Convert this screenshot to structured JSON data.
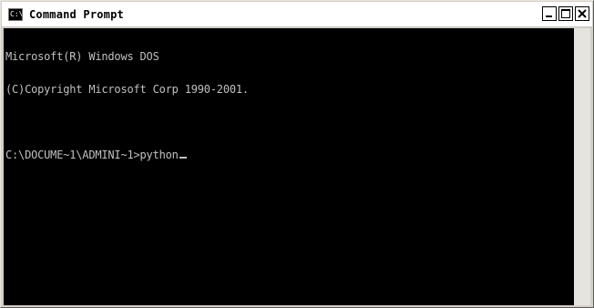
{
  "window": {
    "title": "Command Prompt",
    "icon": "cmd-icon",
    "icon_text": "C:\\",
    "controls": {
      "minimize_icon": "minimize-icon",
      "maximize_icon": "maximize-icon",
      "close_icon": "close-icon"
    }
  },
  "console": {
    "lines": [
      "Microsoft(R) Windows DOS",
      "(C)Copyright Microsoft Corp 1990-2001.",
      "",
      "C:\\DOCUME~1\\ADMINI~1>python"
    ],
    "background": "#000000",
    "foreground": "#c0c0c0"
  }
}
